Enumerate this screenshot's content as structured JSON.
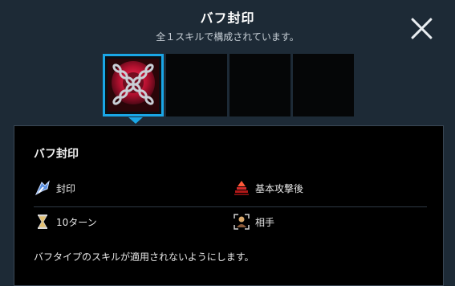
{
  "header": {
    "title": "バフ封印",
    "subtitle": "全１スキルで構成されています。"
  },
  "skill": {
    "name": "バフ封印",
    "attributes": [
      {
        "icon": "seal-icon",
        "label": "封印"
      },
      {
        "icon": "after-basic-attack-icon",
        "label": "基本攻撃後"
      },
      {
        "icon": "hourglass-icon",
        "label": "10ターン"
      },
      {
        "icon": "target-opponent-icon",
        "label": "相手"
      }
    ],
    "description": "バフタイプのスキルが適用されないようにします。"
  },
  "colors": {
    "selection_border": "#1aa6e6",
    "background": "#1d2a36",
    "panel": "#000000"
  }
}
